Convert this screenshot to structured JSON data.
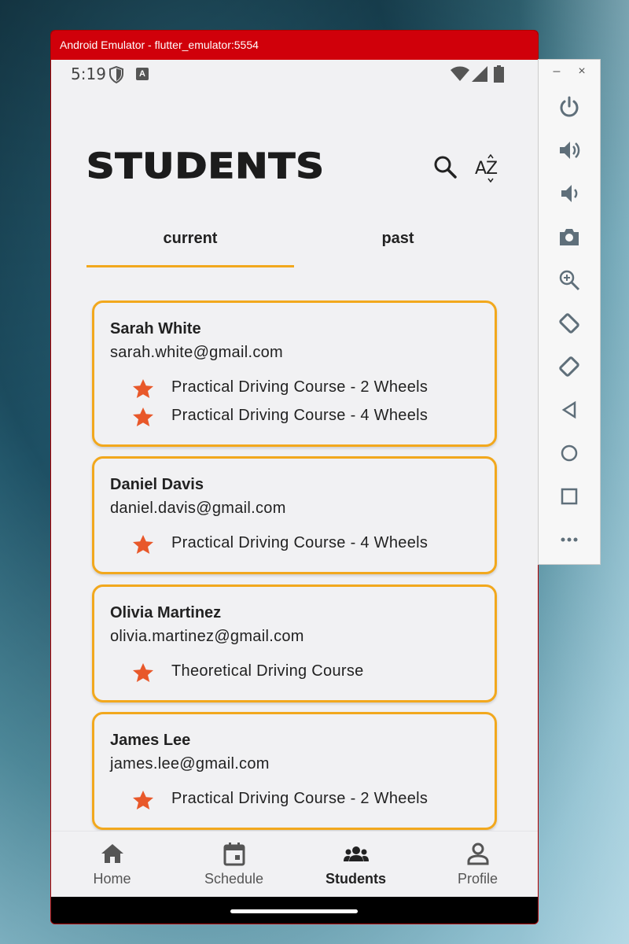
{
  "window": {
    "title": "Android Emulator - flutter_emulator:5554"
  },
  "status_bar": {
    "time": "5:19",
    "notification_letter": "A"
  },
  "header": {
    "title": "STUDENTS",
    "sort_label": "AZ"
  },
  "tabs": [
    {
      "label": "current",
      "selected": true
    },
    {
      "label": "past",
      "selected": false
    }
  ],
  "students": [
    {
      "name": "Sarah White",
      "email": "sarah.white@gmail.com",
      "courses": [
        "Practical Driving Course - 2 Wheels",
        "Practical Driving Course - 4 Wheels"
      ]
    },
    {
      "name": "Daniel Davis",
      "email": "daniel.davis@gmail.com",
      "courses": [
        "Practical Driving Course - 4 Wheels"
      ]
    },
    {
      "name": "Olivia Martinez",
      "email": "olivia.martinez@gmail.com",
      "courses": [
        "Theoretical Driving Course"
      ]
    },
    {
      "name": "James Lee",
      "email": "james.lee@gmail.com",
      "courses": [
        "Practical Driving Course - 2 Wheels"
      ]
    }
  ],
  "bottom_nav": [
    {
      "label": "Home",
      "icon": "home-icon",
      "active": false
    },
    {
      "label": "Schedule",
      "icon": "calendar-icon",
      "active": false
    },
    {
      "label": "Students",
      "icon": "group-icon",
      "active": true
    },
    {
      "label": "Profile",
      "icon": "person-icon",
      "active": false
    }
  ],
  "toolbar": {
    "minimize": "–",
    "close": "×",
    "buttons": [
      "power-icon",
      "volume-up-icon",
      "volume-down-icon",
      "camera-icon",
      "zoom-icon",
      "rotate-left-icon",
      "rotate-right-icon",
      "back-icon",
      "home-circle-icon",
      "overview-icon",
      "more-icon"
    ]
  },
  "colors": {
    "accent": "#f2a81d",
    "star": "#e8582a",
    "titlebar": "#d0000a",
    "screen_bg": "#f1f1f3"
  }
}
